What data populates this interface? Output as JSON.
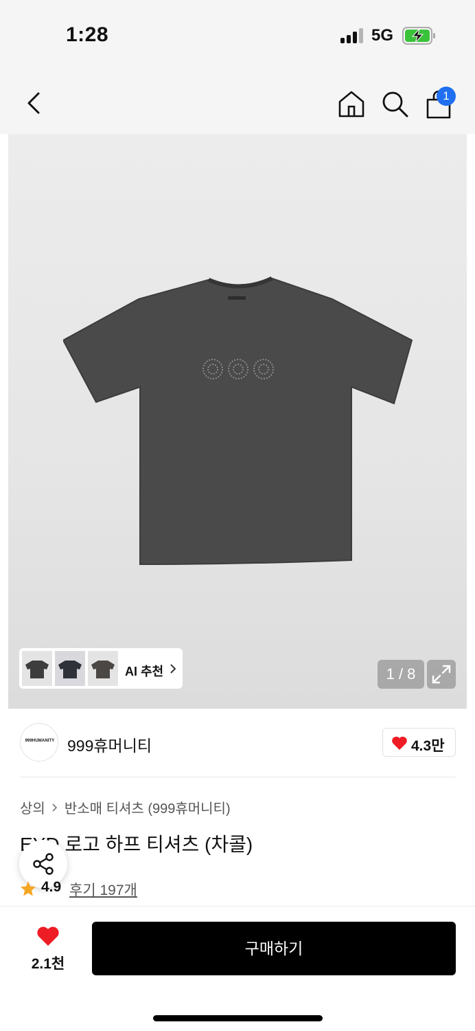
{
  "status_bar": {
    "time": "1:28",
    "network": "5G",
    "icons": [
      "signal-icon",
      "battery-charging-icon"
    ]
  },
  "nav": {
    "icons": [
      "back-icon",
      "home-icon",
      "search-icon",
      "shopping-bag-icon"
    ],
    "cart_badge": "1",
    "badge_color": "#1f6ff0"
  },
  "gallery": {
    "ai_recommend_label": "AI 추천",
    "page_counter": "1 / 8",
    "expand_icon": "expand-icon"
  },
  "brand": {
    "logo_text": "999HUMANITY",
    "name": "999휴머니티",
    "likes": "4.3만"
  },
  "product": {
    "breadcrumb": [
      "상의",
      "반소매 티셔츠 (999휴머니티)"
    ],
    "title": "EYD 로고 하프 티셔츠 (차콜)",
    "rating": "4.9",
    "reviews": "후기 197개"
  },
  "bottom": {
    "wish_count": "2.1천",
    "buy_label": "구매하기"
  },
  "colors": {
    "accent_red": "#ee1c25",
    "star": "#f5a623",
    "buy_button": "#000000"
  }
}
